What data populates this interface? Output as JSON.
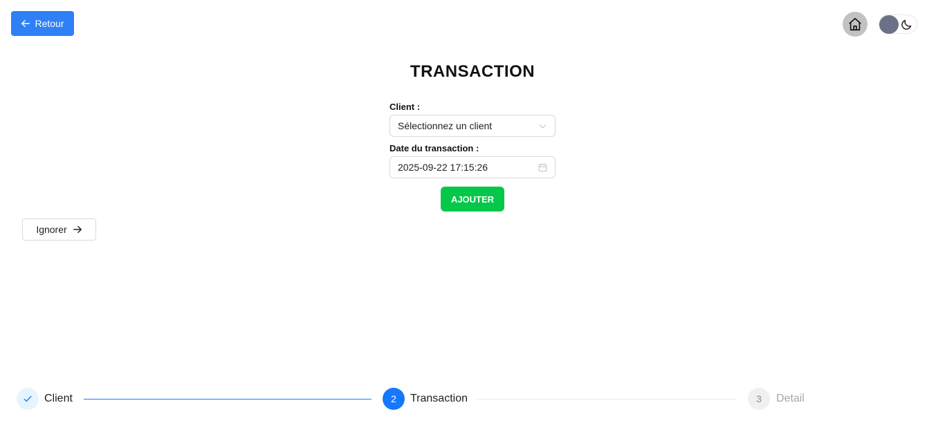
{
  "header": {
    "back_label": "Retour"
  },
  "page": {
    "title": "TRANSACTION"
  },
  "form": {
    "client_label": "Client :",
    "client_placeholder": "Sélectionnez un client",
    "date_label": "Date du transaction :",
    "date_value": "2025-09-22 17:15:26",
    "add_label": "AJOUTER"
  },
  "ignore_label": "Ignorer",
  "steps": [
    {
      "number": "",
      "title": "Client",
      "status": "finished"
    },
    {
      "number": "2",
      "title": "Transaction",
      "status": "process"
    },
    {
      "number": "3",
      "title": "Detail",
      "status": "wait"
    }
  ],
  "colors": {
    "primary": "#2f80f7",
    "success": "#05c84b",
    "step_active": "#1677ff",
    "step_done_bg": "#e6f4ff",
    "step_wait_bg": "#f0f0f0"
  }
}
